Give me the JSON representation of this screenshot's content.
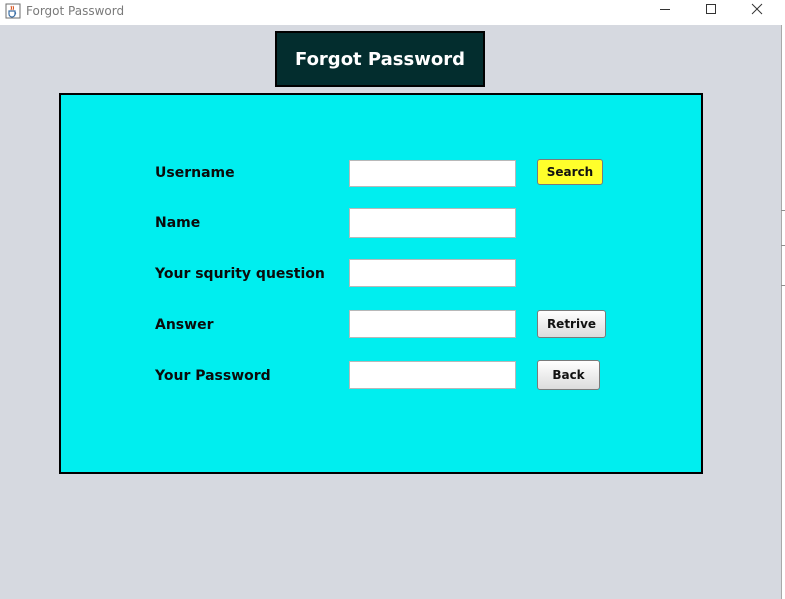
{
  "window": {
    "title": "Forgot Password",
    "icons": {
      "app": "java-cup-icon",
      "minimize": "minimize-icon",
      "maximize": "maximize-icon",
      "close": "close-icon"
    }
  },
  "header": {
    "title": "Forgot Password",
    "background_color": "#032d2e",
    "text_color": "#ffffff"
  },
  "form": {
    "background_color": "#00eeef",
    "fields": [
      {
        "label": "Username",
        "value": ""
      },
      {
        "label": "Name",
        "value": ""
      },
      {
        "label": "Your squrity question",
        "value": ""
      },
      {
        "label": "Answer",
        "value": ""
      },
      {
        "label": "Your Password",
        "value": ""
      }
    ],
    "buttons": {
      "search": {
        "label": "Search",
        "color": "#ffff2b"
      },
      "retrive": {
        "label": "Retrive"
      },
      "back": {
        "label": "Back"
      }
    }
  }
}
